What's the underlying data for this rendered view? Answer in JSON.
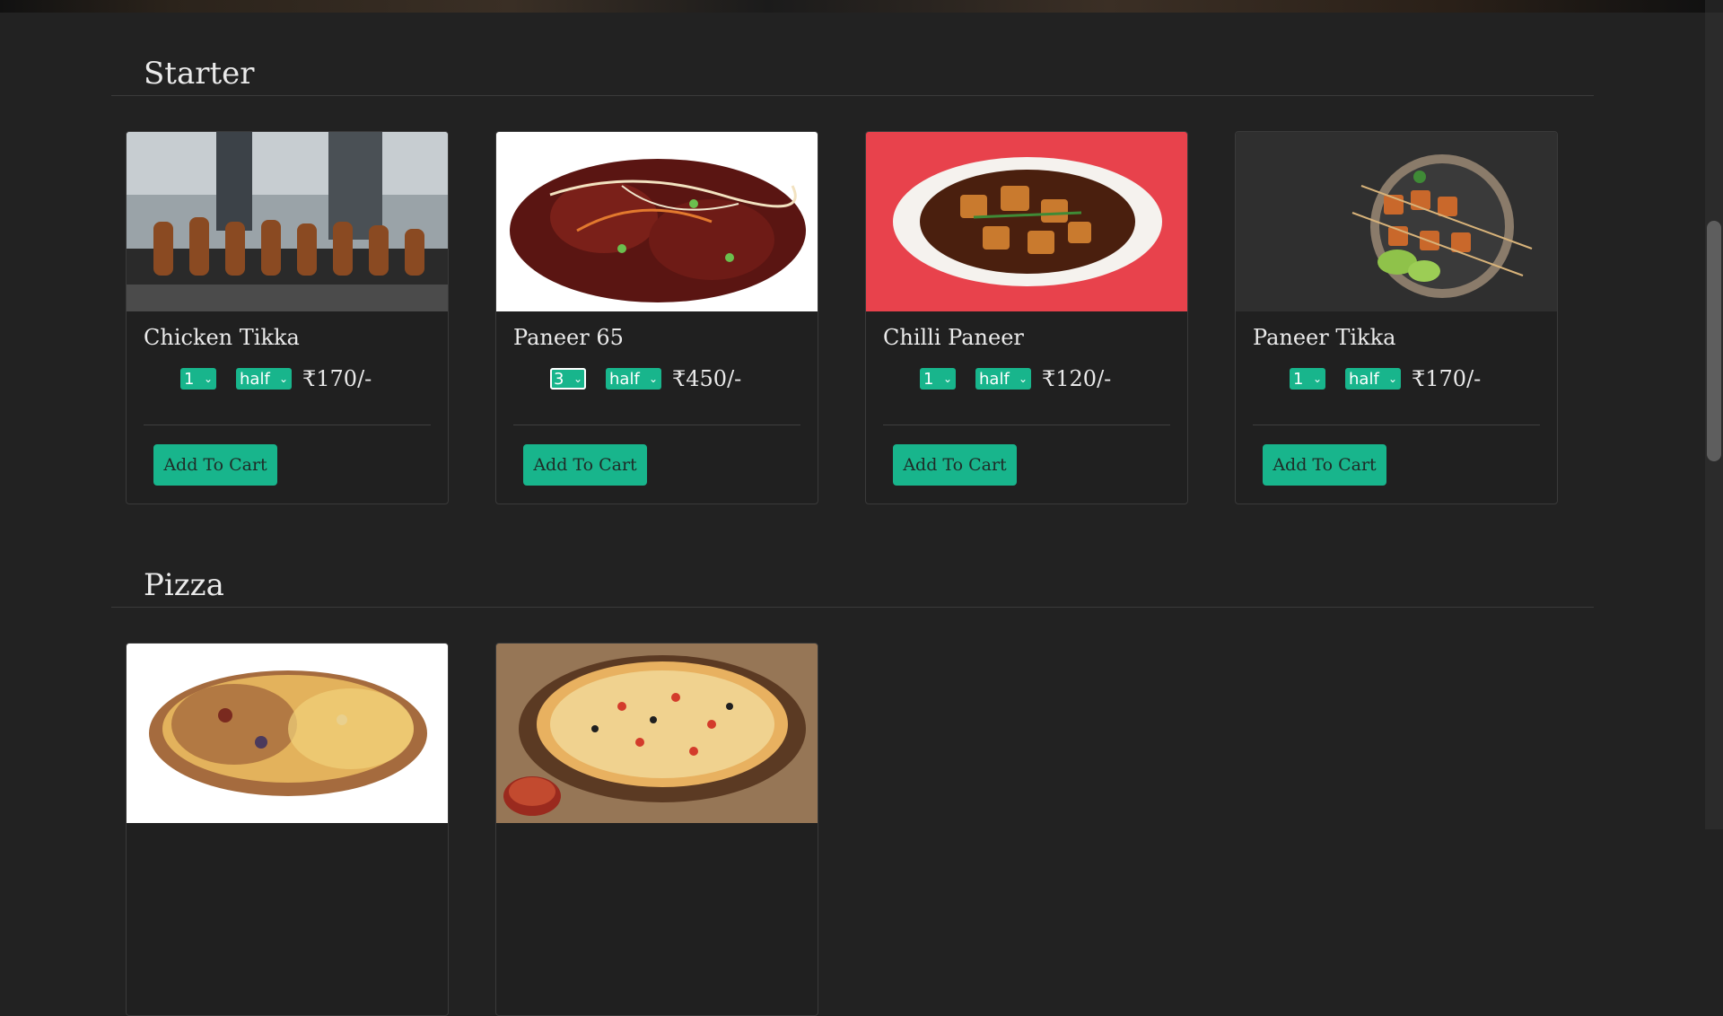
{
  "sections": [
    {
      "title": "Starter",
      "items": [
        {
          "name": "Chicken Tikka",
          "qty": "1",
          "size": "half",
          "price": "₹170/-",
          "button": "Add To Cart"
        },
        {
          "name": "Paneer 65",
          "qty": "3",
          "size": "half",
          "price": "₹450/-",
          "button": "Add To Cart"
        },
        {
          "name": "Chilli Paneer",
          "qty": "1",
          "size": "half",
          "price": "₹120/-",
          "button": "Add To Cart"
        },
        {
          "name": "Paneer Tikka",
          "qty": "1",
          "size": "half",
          "price": "₹170/-",
          "button": "Add To Cart"
        }
      ]
    },
    {
      "title": "Pizza",
      "items": [
        {
          "name": "",
          "qty": "",
          "size": "",
          "price": "",
          "button": ""
        },
        {
          "name": "",
          "qty": "",
          "size": "",
          "price": "",
          "button": ""
        }
      ]
    }
  ],
  "colors": {
    "accent": "#18b58c",
    "background": "#222222"
  }
}
